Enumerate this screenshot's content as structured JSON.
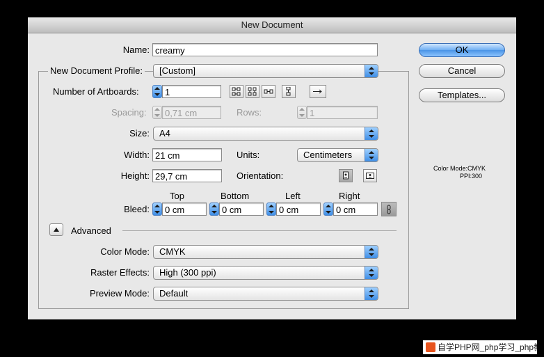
{
  "window": {
    "title": "New Document"
  },
  "name": {
    "label": "Name:",
    "value": "creamy"
  },
  "profile": {
    "label": "New Document Profile:",
    "value": "[Custom]"
  },
  "artboards": {
    "label": "Number of Artboards:",
    "value": "1"
  },
  "spacing": {
    "label": "Spacing:",
    "value": "0,71 cm"
  },
  "rows": {
    "label": "Rows:",
    "value": "1"
  },
  "size": {
    "label": "Size:",
    "value": "A4"
  },
  "width": {
    "label": "Width:",
    "value": "21 cm"
  },
  "units": {
    "label": "Units:",
    "value": "Centimeters"
  },
  "height": {
    "label": "Height:",
    "value": "29,7 cm"
  },
  "orientation": {
    "label": "Orientation:"
  },
  "bleed": {
    "label": "Bleed:",
    "top": {
      "label": "Top",
      "value": "0 cm"
    },
    "bottom": {
      "label": "Bottom",
      "value": "0 cm"
    },
    "left": {
      "label": "Left",
      "value": "0 cm"
    },
    "right": {
      "label": "Right",
      "value": "0 cm"
    }
  },
  "advanced": {
    "label": "Advanced"
  },
  "color_mode": {
    "label": "Color Mode:",
    "value": "CMYK"
  },
  "raster_effects": {
    "label": "Raster Effects:",
    "value": "High (300 ppi)"
  },
  "preview_mode": {
    "label": "Preview Mode:",
    "value": "Default"
  },
  "buttons": {
    "ok": "OK",
    "cancel": "Cancel",
    "templates": "Templates..."
  },
  "info": {
    "color_mode": "Color Mode:CMYK",
    "ppi": "PPI:300"
  },
  "watermark": {
    "text": "自学PHP网_php学习_php教"
  },
  "colors": {
    "accent": "#4a94e6",
    "dialog_bg": "#e8e8e8",
    "backdrop": "#000000"
  },
  "icons": [
    "grid-by-row-icon",
    "grid-by-column-icon",
    "arrange-by-row-icon",
    "arrange-by-column-icon",
    "arrow-right-icon",
    "portrait-icon",
    "landscape-icon",
    "link-icon",
    "disclosure-triangle-icon"
  ]
}
